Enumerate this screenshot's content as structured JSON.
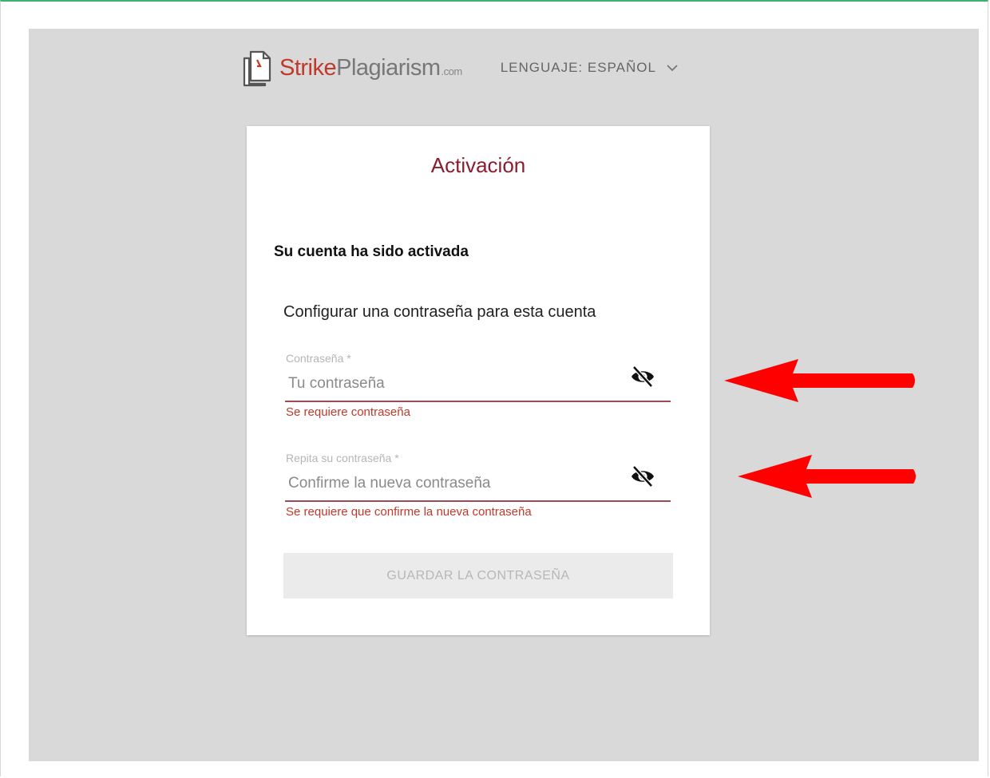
{
  "header": {
    "logo": {
      "strike": "Strike",
      "plagiarism": "Plagiarism",
      "com": ".com"
    },
    "language_label": "LENGUAJE: ESPAÑOL",
    "logo_icon": "document-icon",
    "language_icon": "chevron-down-icon"
  },
  "card": {
    "title": "Activación",
    "activated_message": "Su cuenta ha sido activada",
    "configure_message": "Configurar una contraseña para esta cuenta",
    "password": {
      "label": "Contraseña *",
      "placeholder": "Tu contraseña",
      "value": "",
      "error": "Se requiere contraseña",
      "toggle_icon": "eye-off-icon"
    },
    "confirm_password": {
      "label": "Repita su contraseña *",
      "placeholder": "Confirme la nueva contraseña",
      "value": "",
      "error": "Se requiere que confirme la nueva contraseña",
      "toggle_icon": "eye-off-icon"
    },
    "save_button": "GUARDAR LA CONTRASEÑA"
  },
  "annotations": {
    "arrow_color": "#ff0000",
    "arrow_icon": "arrow-left-icon"
  },
  "colors": {
    "title": "#8b1e2e",
    "error": "#c0392b",
    "brand": "#c0392b",
    "panel": "#d9d9d9"
  }
}
